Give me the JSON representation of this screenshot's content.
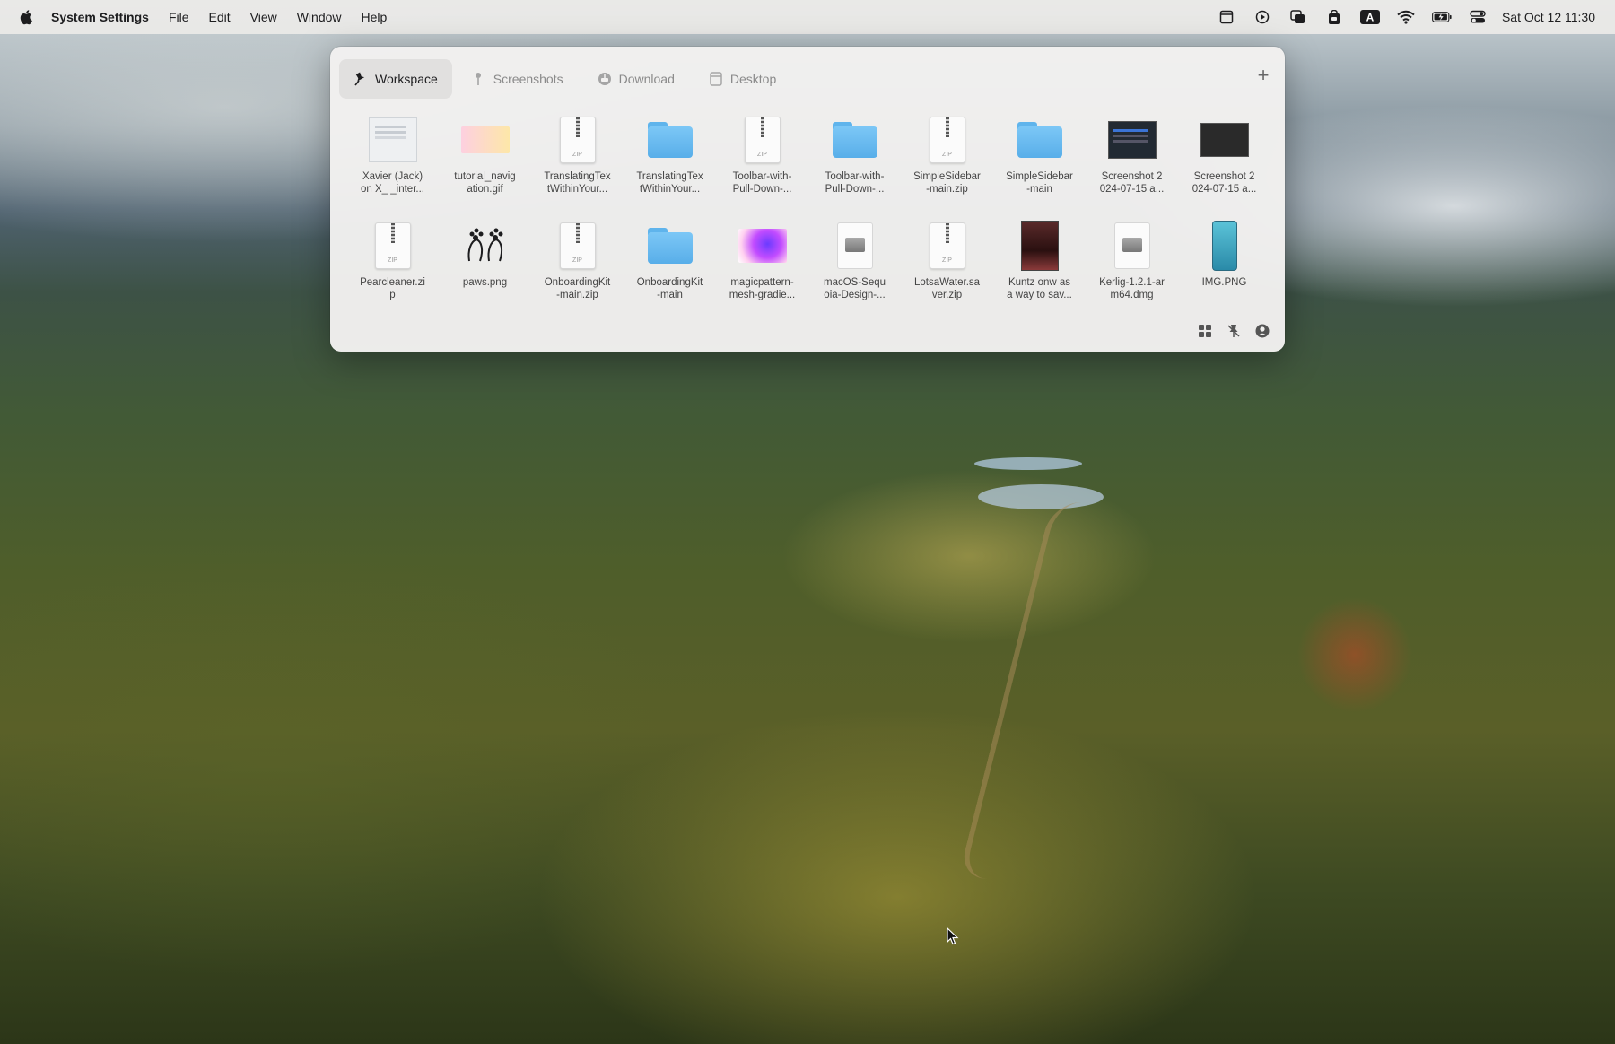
{
  "menubar": {
    "app_name": "System Settings",
    "items": [
      "File",
      "Edit",
      "View",
      "Window",
      "Help"
    ],
    "status_icons": [
      "note-icon",
      "play-icon",
      "windows-icon",
      "bag-icon",
      "keyboard-a-icon",
      "wifi-icon",
      "battery-icon",
      "control-center-icon"
    ],
    "clock": "Sat Oct 12  11:30"
  },
  "panel": {
    "tabs": [
      {
        "label": "Workspace",
        "icon": "pin-icon",
        "active": true
      },
      {
        "label": "Screenshots",
        "icon": "pin-icon",
        "active": false
      },
      {
        "label": "Download",
        "icon": "download-icon",
        "active": false
      },
      {
        "label": "Desktop",
        "icon": "desktop-icon",
        "active": false
      }
    ],
    "add_label": "+",
    "items": [
      {
        "label": "Xavier (Jack)\non X_ _inter...",
        "kind": "image-doc"
      },
      {
        "label": "tutorial_navig\nation.gif",
        "kind": "gif"
      },
      {
        "label": "TranslatingTex\ntWithinYour...",
        "kind": "zip"
      },
      {
        "label": "TranslatingTex\ntWithinYour...",
        "kind": "folder"
      },
      {
        "label": "Toolbar-with-\nPull-Down-...",
        "kind": "zip"
      },
      {
        "label": "Toolbar-with-\nPull-Down-...",
        "kind": "folder"
      },
      {
        "label": "SimpleSidebar\n-main.zip",
        "kind": "zip"
      },
      {
        "label": "SimpleSidebar\n-main",
        "kind": "folder"
      },
      {
        "label": "Screenshot 2\n024-07-15 a...",
        "kind": "screenshot-dark"
      },
      {
        "label": "Screenshot 2\n024-07-15 a...",
        "kind": "screenshot-black"
      },
      {
        "label": "Pearcleaner.zi\np",
        "kind": "zip"
      },
      {
        "label": "paws.png",
        "kind": "paws"
      },
      {
        "label": "OnboardingKit\n-main.zip",
        "kind": "zip"
      },
      {
        "label": "OnboardingKit\n-main",
        "kind": "folder"
      },
      {
        "label": "magicpattern-\nmesh-gradie...",
        "kind": "mesh"
      },
      {
        "label": "macOS-Sequ\noia-Design-...",
        "kind": "dmg"
      },
      {
        "label": "LotsaWater.sa\nver.zip",
        "kind": "zip"
      },
      {
        "label": "Kuntz onw as\na way to sav...",
        "kind": "photo"
      },
      {
        "label": "Kerlig-1.2.1-ar\nm64.dmg",
        "kind": "dmg"
      },
      {
        "label": "IMG.PNG",
        "kind": "phone-png"
      }
    ],
    "bottom_icons": [
      "grid-icon",
      "unpin-icon",
      "account-icon"
    ]
  }
}
